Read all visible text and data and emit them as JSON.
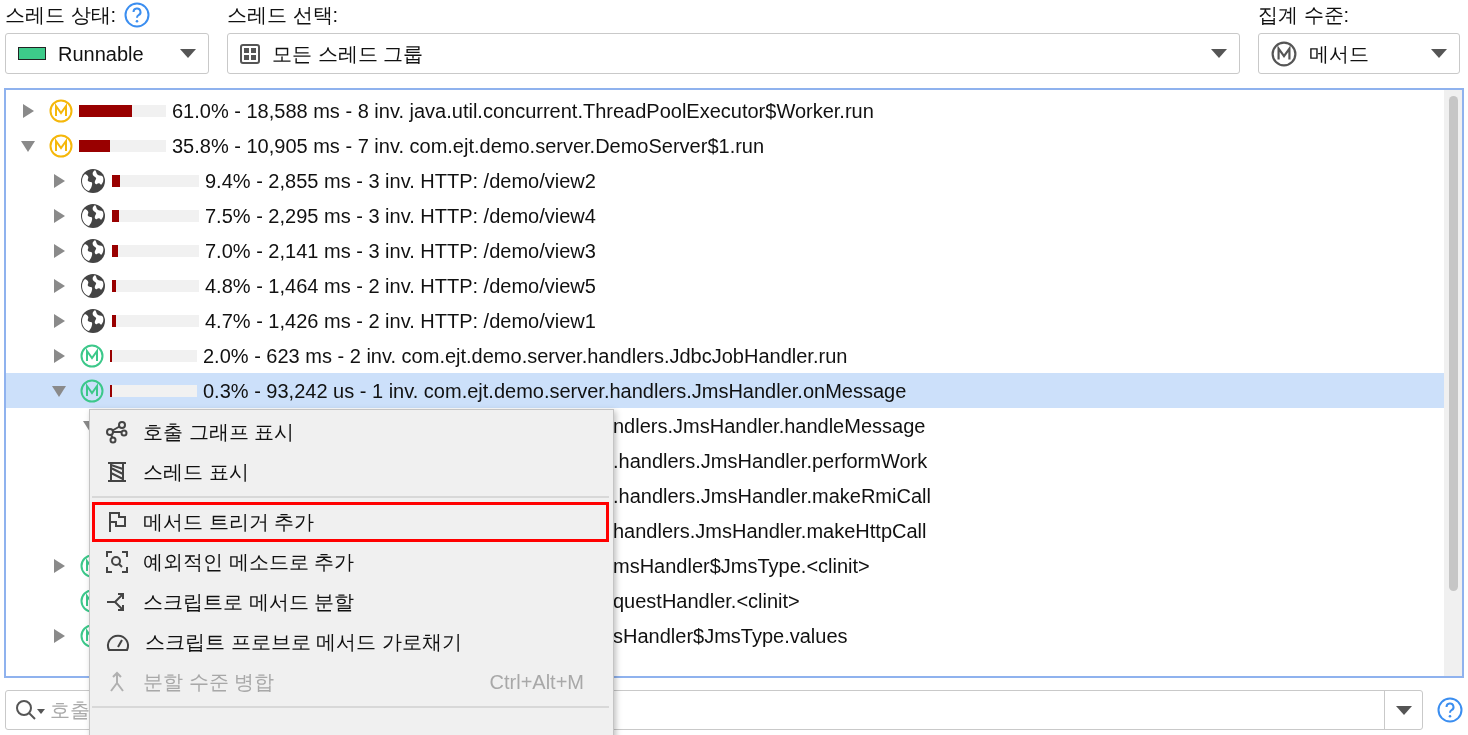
{
  "filters": [
    {
      "kind": "state",
      "label": "스레드 상태:",
      "value": "Runnable"
    },
    {
      "kind": "threads",
      "label": "스레드 선택:",
      "value": "모든 스레드 그룹"
    },
    {
      "kind": "aggregation",
      "label": "집계 수준:",
      "value": "메서드"
    }
  ],
  "tree": [
    {
      "kind": "method",
      "color": "#f5b70a",
      "level": 0.61,
      "text": "61.0% - 18,588 ms - 8 inv. java.util.concurrent.ThreadPoolExecutor$Worker.run",
      "expanded": false,
      "selected": false
    },
    {
      "kind": "method",
      "color": "#f5b70a",
      "level": 0.358,
      "text": "35.8% - 10,905 ms - 7 inv. com.ejt.demo.server.DemoServer$1.run",
      "expanded": true,
      "selected": false,
      "children": [
        {
          "kind": "http",
          "level": 0.094,
          "text": "9.4% - 2,855 ms - 3 inv. HTTP: /demo/view2",
          "expanded": false,
          "selected": false
        },
        {
          "kind": "http",
          "level": 0.075,
          "text": "7.5% - 2,295 ms - 3 inv. HTTP: /demo/view4",
          "expanded": false,
          "selected": false
        },
        {
          "kind": "http",
          "level": 0.07,
          "text": "7.0% - 2,141 ms - 3 inv. HTTP: /demo/view3",
          "expanded": false,
          "selected": false
        },
        {
          "kind": "http",
          "level": 0.048,
          "text": "4.8% - 1,464 ms - 2 inv. HTTP: /demo/view5",
          "expanded": false,
          "selected": false
        },
        {
          "kind": "http",
          "level": 0.047,
          "text": "4.7% - 1,426 ms - 2 inv. HTTP: /demo/view1",
          "expanded": false,
          "selected": false
        },
        {
          "kind": "method",
          "color": "#3cc88a",
          "level": 0.02,
          "text": "2.0% - 623 ms - 2 inv. com.ejt.demo.server.handlers.JdbcJobHandler.run",
          "expanded": false,
          "selected": false
        },
        {
          "kind": "method",
          "color": "#3cc88a",
          "level": 0.003,
          "text": "0.3% - 93,242 us - 1 inv. com.ejt.demo.server.handlers.JmsHandler.onMessage",
          "expanded": true,
          "selected": true,
          "children": [
            {
              "kind": "covered",
              "text": "ndlers.JmsHandler.handleMessage",
              "expanded": true,
              "selected": false,
              "children": [
                {
                  "kind": "covered",
                  "text": ".handlers.JmsHandler.performWork",
                  "selected": false
                },
                {
                  "kind": "covered",
                  "text": ".handlers.JmsHandler.makeRmiCall",
                  "selected": false
                },
                {
                  "kind": "covered",
                  "text": "handlers.JmsHandler.makeHttpCall",
                  "selected": false
                }
              ]
            }
          ]
        },
        {
          "kind": "covered",
          "color": "#3cc88a",
          "text": "msHandler$JmsType.<clinit>",
          "expanded": false,
          "selected": false
        },
        {
          "kind": "covered",
          "color": "#3cc88a",
          "text": "questHandler.<clinit>",
          "selected": false
        },
        {
          "kind": "covered",
          "color": "#3cc88a",
          "text": "sHandler$JmsType.values",
          "expanded": false,
          "selected": false
        }
      ]
    }
  ],
  "context_menu": [
    {
      "kind": "graph",
      "label": "호출 그래프 표시",
      "disabled": false,
      "highlighted": false
    },
    {
      "kind": "spool",
      "label": "스레드 표시",
      "disabled": false,
      "highlighted": false
    },
    {
      "kind": "separator"
    },
    {
      "kind": "flag",
      "label": "메서드 트리거 추가",
      "disabled": false,
      "highlighted": true
    },
    {
      "kind": "scan",
      "label": "예외적인 메소드로 추가",
      "disabled": false,
      "highlighted": false
    },
    {
      "kind": "split",
      "label": "스크립트로 메서드 분할",
      "disabled": false,
      "highlighted": false
    },
    {
      "kind": "gauge",
      "label": "스크립트 프로브로 메서드 가로채기",
      "disabled": false,
      "highlighted": false
    },
    {
      "kind": "merge",
      "label": "분할 수준 병합",
      "disabled": true,
      "highlighted": false,
      "shortcut": "Ctrl+Alt+M"
    },
    {
      "kind": "separator"
    }
  ],
  "search": {
    "placeholder": "호출"
  }
}
